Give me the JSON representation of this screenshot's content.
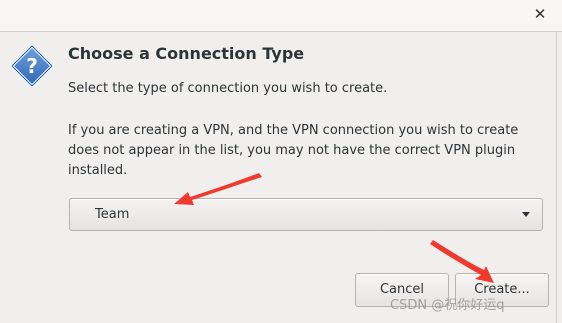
{
  "window": {
    "close_glyph": "✕"
  },
  "dialog": {
    "icon": "question-icon",
    "heading": "Choose a Connection Type",
    "subtext": "Select the type of connection you wish to create.",
    "note_line1": "If you are creating a VPN, and the VPN connection you wish to create",
    "note_line2": "does not appear in the list, you may not have the correct VPN plugin",
    "note_line3": "installed."
  },
  "type_select": {
    "selected": "Team"
  },
  "buttons": {
    "cancel_label": "Cancel",
    "create_label": "Create..."
  },
  "annotations": {
    "arrow_color": "#f03a2e"
  },
  "watermark": {
    "text": "CSDN @祝你好运q"
  },
  "colors": {
    "background": "#f0efee",
    "text": "#2e3436",
    "icon_blue": "#3a77c4"
  }
}
